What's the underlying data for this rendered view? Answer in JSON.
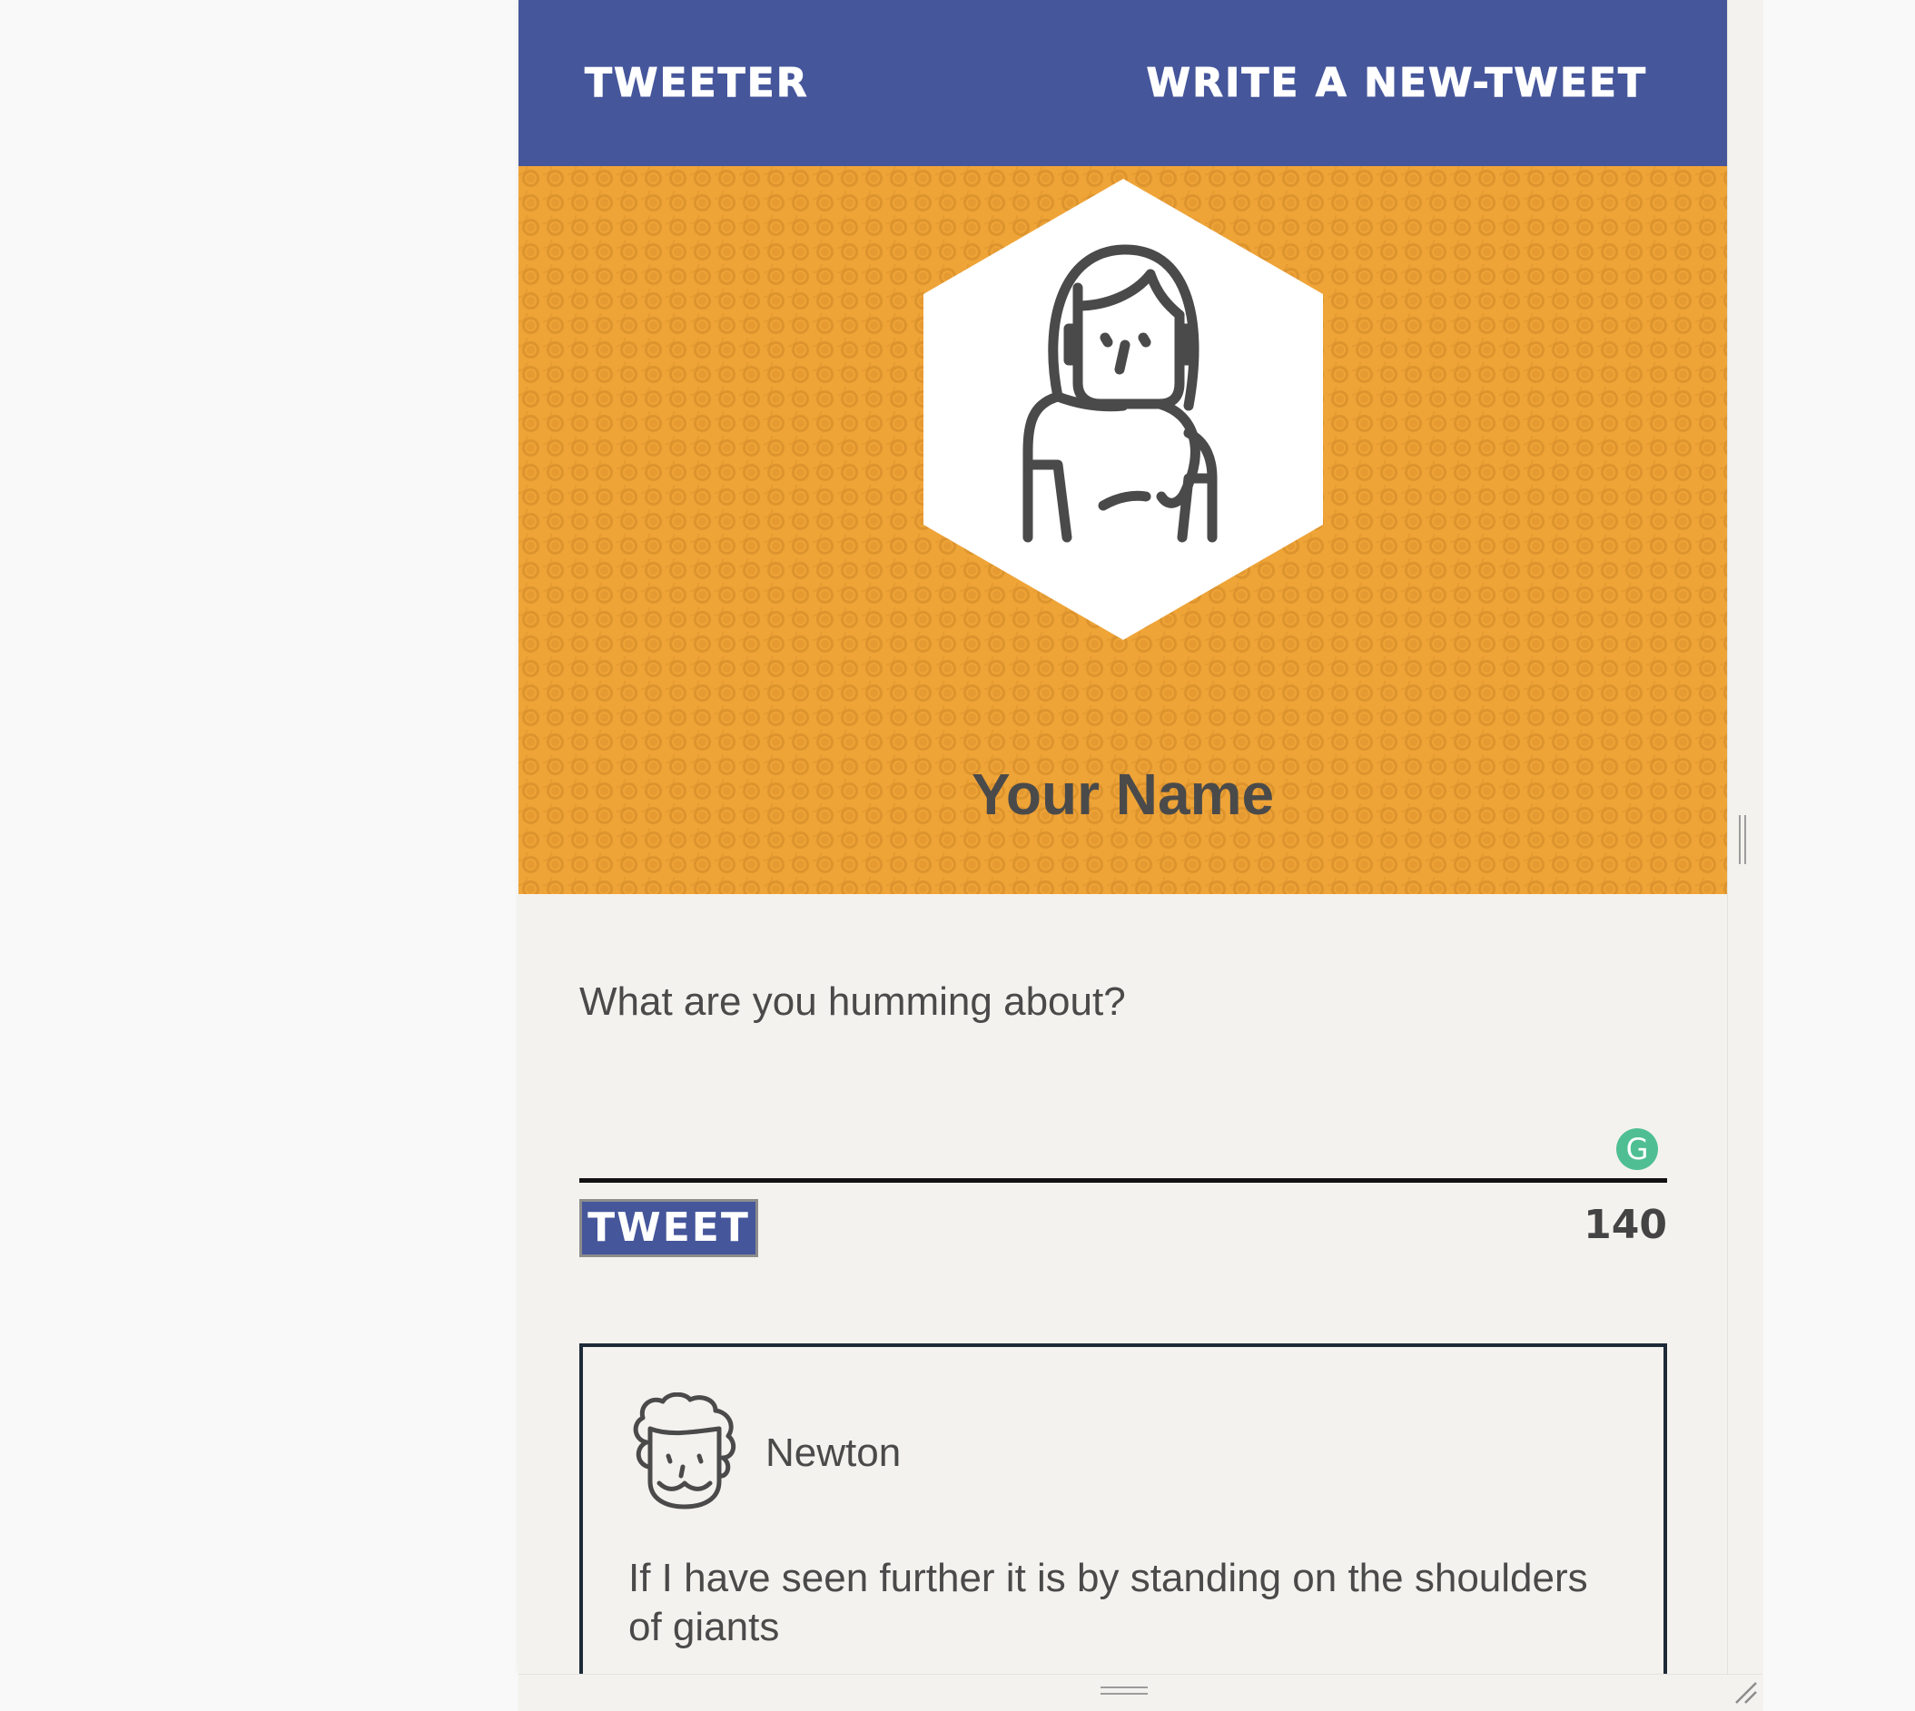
{
  "nav": {
    "logo": "Tweeter",
    "compose_label": "Write a new-tweet"
  },
  "profile": {
    "name": "Your Name",
    "avatar_icon": "woman-avatar-icon"
  },
  "composer": {
    "placeholder": "What are you humming about?",
    "value": "",
    "tweet_label": "Tweet",
    "char_counter": "140",
    "grammarly_glyph": "G"
  },
  "tweets": [
    {
      "author": "Newton",
      "avatar_icon": "man-avatar-icon",
      "text": "If I have seen further it is by standing on the shoulders of giants"
    }
  ],
  "colors": {
    "nav_bg": "#45569b",
    "banner_bg": "#efa437",
    "page_bg": "#f4f2ee",
    "text": "#4a4a4a",
    "grammarly": "#4fbf93"
  }
}
